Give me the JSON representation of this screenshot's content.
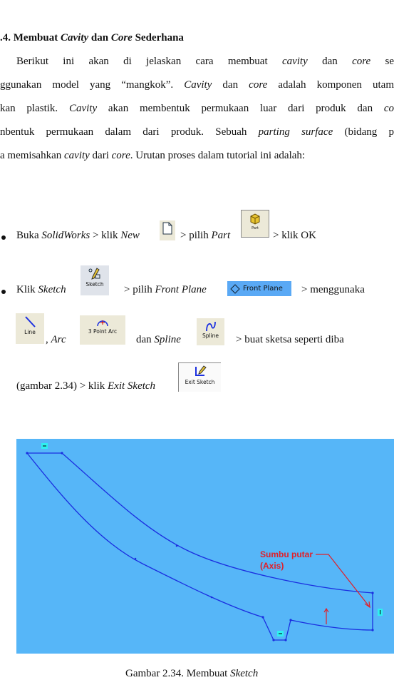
{
  "heading": [
    {
      "t": ".4. Membuat "
    },
    {
      "t": "Cavity",
      "i": true
    },
    {
      "t": " dan "
    },
    {
      "t": "Core",
      "i": true
    },
    {
      "t": " Sederhana"
    }
  ],
  "paragraph": [
    [
      {
        "t": "Berikut ini akan di jelaskan cara membuat "
      },
      {
        "t": "cavity",
        "i": true
      },
      {
        "t": " dan "
      },
      {
        "t": "core",
        "i": true
      },
      {
        "t": " se"
      }
    ],
    [
      {
        "t": "ggunakan model yang “mangkok”. "
      },
      {
        "t": "Cavity",
        "i": true
      },
      {
        "t": " dan "
      },
      {
        "t": "core",
        "i": true
      },
      {
        "t": " adalah komponen utam"
      }
    ],
    [
      {
        "t": "kan plastik. "
      },
      {
        "t": "Cavity",
        "i": true
      },
      {
        "t": " akan membentuk permukaan luar dari produk dan "
      },
      {
        "t": "co",
        "i": true
      }
    ],
    [
      {
        "t": "nbentuk permukaan dalam dari produk. Sebuah "
      },
      {
        "t": "parting surface",
        "i": true
      },
      {
        "t": " (bidang p"
      }
    ],
    [
      {
        "t": "a memisahkan "
      },
      {
        "t": "cavity",
        "i": true
      },
      {
        "t": " dari "
      },
      {
        "t": "core",
        "i": true
      },
      {
        "t": ". Urutan proses dalam tutorial ini adalah:"
      }
    ]
  ],
  "bullet1": {
    "seg1": [
      {
        "t": "Buka "
      },
      {
        "t": "SolidWorks",
        "i": true
      },
      {
        "t": " > klik "
      },
      {
        "t": "New",
        "i": true
      }
    ],
    "seg2": [
      {
        "t": "> pilih "
      },
      {
        "t": "Part",
        "i": true
      }
    ],
    "seg3": [
      {
        "t": "> klik OK"
      }
    ]
  },
  "bullet2": {
    "seg1": [
      {
        "t": "Klik  "
      },
      {
        "t": "Sketch",
        "i": true
      }
    ],
    "seg2": [
      {
        "t": ">  pilih  "
      },
      {
        "t": "Front  Plane",
        "i": true
      }
    ],
    "seg3": [
      {
        "t": ">  menggunaka"
      }
    ],
    "seg4": [
      {
        "t": ",  "
      },
      {
        "t": "Arc",
        "i": true
      }
    ],
    "seg5": [
      {
        "t": "dan  "
      },
      {
        "t": "Spline",
        "i": true
      }
    ],
    "seg6": [
      {
        "t": ">  buat  sketsa  seperti  diba"
      }
    ],
    "seg7": [
      {
        "t": "(gambar 2.34) > klik "
      },
      {
        "t": "Exit Sketch",
        "i": true
      }
    ]
  },
  "icons": {
    "part_label": "Part",
    "sketch_label": "Sketch",
    "front_plane_label": "Front Plane",
    "line_label": "Line",
    "arc_label": "3 Point Arc",
    "spline_label": "Spline",
    "exit_sketch_label": "Exit Sketch"
  },
  "figure": {
    "annotation_line1": "Sumbu putar",
    "annotation_line2": "(Axis)",
    "background": "#56b6f8",
    "sketch_color": "#1b2fe0",
    "annotation_color": "#e0202a"
  },
  "caption": [
    {
      "t": "Gambar 2.34. Membuat "
    },
    {
      "t": "Sketch",
      "i": true
    }
  ]
}
